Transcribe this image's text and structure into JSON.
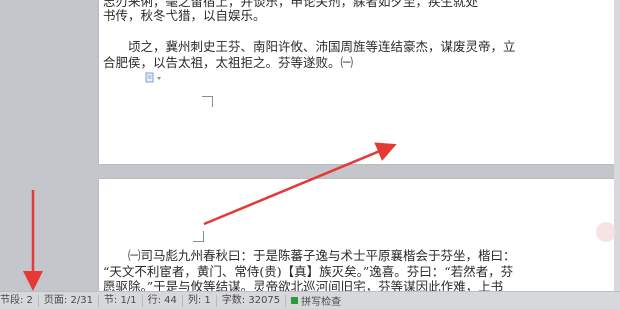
{
  "document": {
    "page1_lines": [
      "志刃来俐，毫之留宿上，并谈乐，申论关剂，寐者如夕至，疾生就处",
      "书传，秋冬弋猎，以自娱乐。",
      "",
      "　　顷之，冀州刺史王芬、南阳许攸、沛国周旌等连结豪杰，谋废灵帝，立",
      "合肥侯，以告太祖，太祖拒之。芬等遂败。㈠"
    ],
    "page2_lines": [
      "　　㈠司马彪九州春秋曰：于是陈蕃子逸与术士平原襄楷会于芬坐，楷曰：",
      "“天文不利宦者，黄门、常侍(贵)【真】族灭矣。”逸喜。芬曰：“若然者，芬",
      "愿驱除。”于是与攸等结谋。灵帝欲北巡河间旧宅，芬等谋因此作难，上书"
    ]
  },
  "statusbar": {
    "section_para": "节段: 2",
    "page": "页面: 2/31",
    "section": "节: 1/1",
    "row": "行: 44",
    "col": "列: 1",
    "word_count": "字数: 32075",
    "spell_check": "拼写检查"
  },
  "colors": {
    "annotation_arrow": "#e53935",
    "spell_check_indicator": "#2e9b3a"
  },
  "icons": [
    "document-icon",
    "dropdown-arrow-icon"
  ]
}
